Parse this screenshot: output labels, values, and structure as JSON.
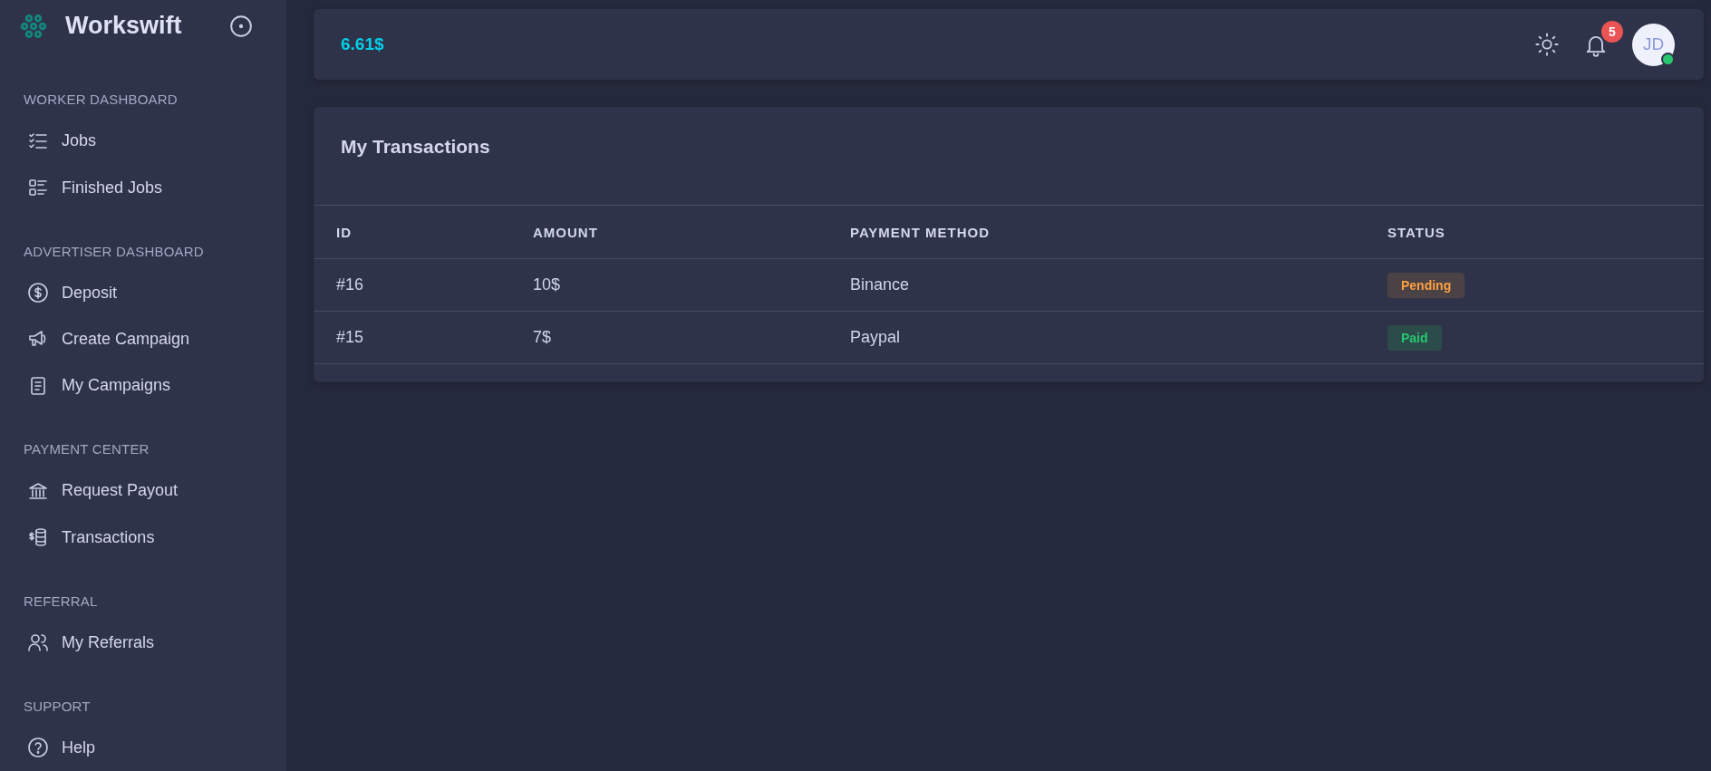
{
  "sidebar": {
    "brand": "Workswift",
    "sections": [
      {
        "title": "WORKER DASHBOARD",
        "items": [
          {
            "label": "Jobs",
            "kind": "checklist"
          },
          {
            "label": "Finished Jobs",
            "kind": "list"
          }
        ]
      },
      {
        "title": "ADVERTISER DASHBOARD",
        "items": [
          {
            "label": "Deposit",
            "kind": "dollar"
          },
          {
            "label": "Create Campaign",
            "kind": "megaphone"
          },
          {
            "label": "My Campaigns",
            "kind": "document"
          }
        ]
      },
      {
        "title": "PAYMENT CENTER",
        "items": [
          {
            "label": "Request Payout",
            "kind": "bank"
          },
          {
            "label": "Transactions",
            "kind": "coins"
          }
        ]
      },
      {
        "title": "REFERRAL",
        "items": [
          {
            "label": "My Referrals",
            "kind": "users"
          }
        ]
      },
      {
        "title": "SUPPORT",
        "items": [
          {
            "label": "Help",
            "kind": "help"
          }
        ]
      }
    ]
  },
  "header": {
    "balance": "6.61$",
    "notifications": "5",
    "avatar": {
      "initials": "JD",
      "online": true
    }
  },
  "transactions": {
    "title": "My Transactions",
    "columns": [
      "ID",
      "AMOUNT",
      "PAYMENT METHOD",
      "STATUS"
    ],
    "rows": [
      {
        "id": "#16",
        "amount": "10$",
        "method": "Binance",
        "status": "Pending",
        "kind": "pending"
      },
      {
        "id": "#15",
        "amount": "7$",
        "method": "Paypal",
        "status": "Paid",
        "kind": "paid"
      }
    ]
  }
}
